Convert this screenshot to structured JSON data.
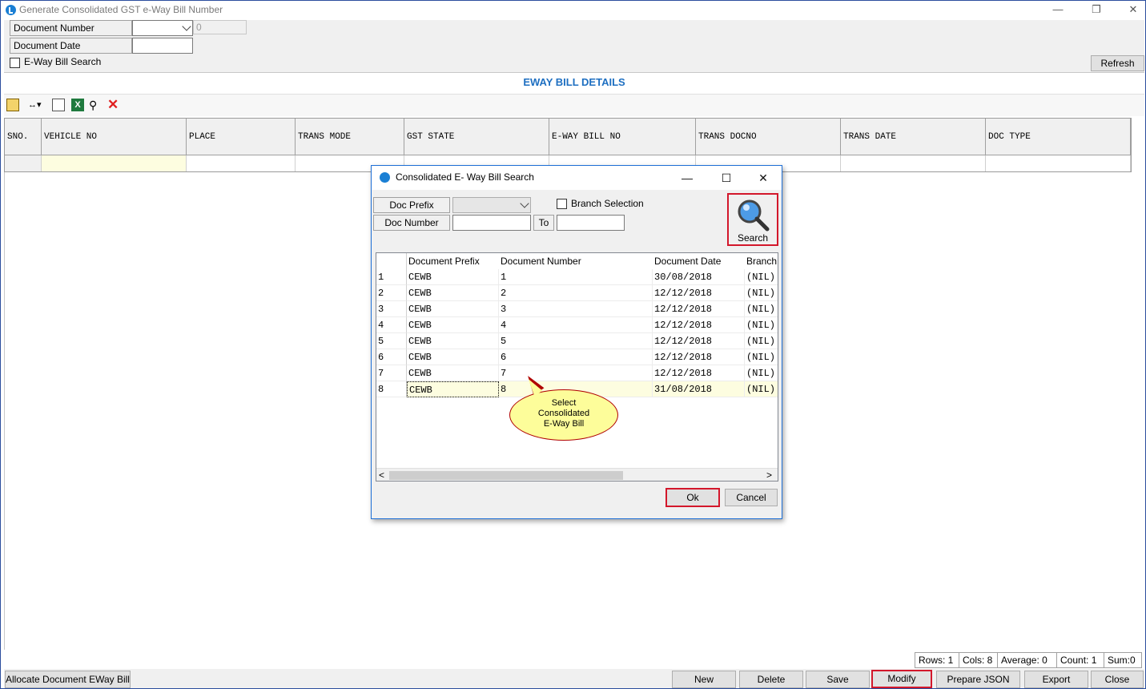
{
  "window": {
    "title": "Generate Consolidated GST e-Way Bill Number",
    "minimize": "—",
    "restore": "❐",
    "close": "✕"
  },
  "header": {
    "doc_number_label": "Document Number",
    "doc_number_value": "0",
    "doc_date_label": "Document Date",
    "eway_search_label": "E-Way Bill Search",
    "refresh_label": "Refresh"
  },
  "section_title": "EWAY BILL DETAILS",
  "toolbar": {
    "icons": [
      "layout-icon",
      "column-resize-icon",
      "copy-icon",
      "excel-icon",
      "find-icon",
      "delete-icon"
    ]
  },
  "grid": {
    "columns": [
      "SNO.",
      "VEHICLE NO",
      "PLACE",
      "TRANS MODE",
      "GST STATE",
      "E-WAY BILL NO",
      "TRANS DOCNO",
      "TRANS DATE",
      "DOC TYPE"
    ]
  },
  "status": {
    "rows": "Rows: 1",
    "cols": "Cols: 8",
    "average": "Average: 0",
    "count": "Count: 1",
    "sum": "Sum:0"
  },
  "bottom_buttons": {
    "allocate": "Allocate Document EWay Bill",
    "new": "New",
    "delete": "Delete",
    "save": "Save",
    "modify": "Modify",
    "prepare_json": "Prepare JSON",
    "export": "Export",
    "close": "Close"
  },
  "dialog": {
    "title": "Consolidated E- Way Bill Search",
    "minimize": "—",
    "maximize": "☐",
    "close": "✕",
    "doc_prefix_label": "Doc Prefix",
    "doc_number_label": "Doc Number",
    "to_label": "To",
    "branch_selection_label": "Branch Selection",
    "search_label": "Search",
    "columns": [
      "Document Prefix",
      "Document Number",
      "Document Date",
      "Branch"
    ],
    "rows": [
      {
        "n": "1",
        "prefix": "CEWB",
        "number": "1",
        "date": "30/08/2018",
        "branch": "(NIL)"
      },
      {
        "n": "2",
        "prefix": "CEWB",
        "number": "2",
        "date": "12/12/2018",
        "branch": "(NIL)"
      },
      {
        "n": "3",
        "prefix": "CEWB",
        "number": "3",
        "date": "12/12/2018",
        "branch": "(NIL)"
      },
      {
        "n": "4",
        "prefix": "CEWB",
        "number": "4",
        "date": "12/12/2018",
        "branch": "(NIL)"
      },
      {
        "n": "5",
        "prefix": "CEWB",
        "number": "5",
        "date": "12/12/2018",
        "branch": "(NIL)"
      },
      {
        "n": "6",
        "prefix": "CEWB",
        "number": "6",
        "date": "12/12/2018",
        "branch": "(NIL)"
      },
      {
        "n": "7",
        "prefix": "CEWB",
        "number": "7",
        "date": "12/12/2018",
        "branch": "(NIL)"
      },
      {
        "n": "8",
        "prefix": "CEWB",
        "number": "8",
        "date": "31/08/2018",
        "branch": "(NIL)"
      }
    ],
    "callout": {
      "line1": "Select",
      "line2": "Consolidated",
      "line3": "E-Way Bill"
    },
    "scroll_left": "<",
    "scroll_right": ">",
    "ok_label": "Ok",
    "cancel_label": "Cancel"
  }
}
